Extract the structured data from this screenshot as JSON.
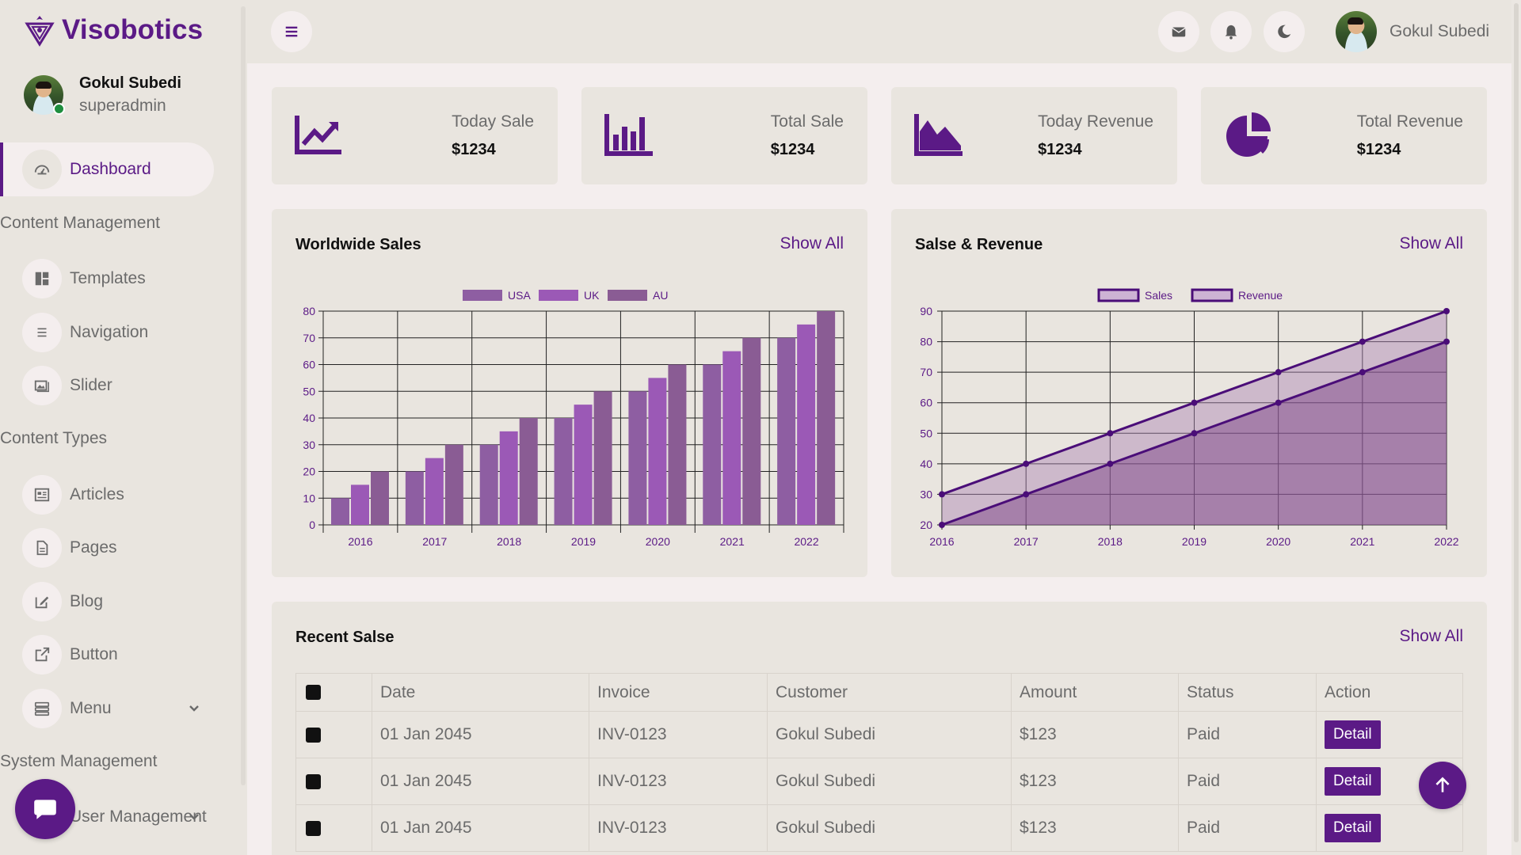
{
  "brand": {
    "name": "Visobotics"
  },
  "user": {
    "name": "Gokul Subedi",
    "role": "superadmin"
  },
  "sidebar": {
    "dashboard": "Dashboard",
    "sections": [
      "Content Management",
      "Content Types",
      "System Management"
    ],
    "items": [
      {
        "label": "Templates",
        "icon": "templates-icon"
      },
      {
        "label": "Navigation",
        "icon": "navigation-icon"
      },
      {
        "label": "Slider",
        "icon": "slider-icon"
      },
      {
        "label": "Articles",
        "icon": "articles-icon"
      },
      {
        "label": "Pages",
        "icon": "pages-icon"
      },
      {
        "label": "Blog",
        "icon": "blog-icon"
      },
      {
        "label": "Button",
        "icon": "button-icon"
      },
      {
        "label": "Menu",
        "icon": "menu-icon"
      },
      {
        "label": "User Management",
        "icon": "user-management-icon"
      }
    ]
  },
  "topbar": {
    "user_name": "Gokul Subedi"
  },
  "stats": [
    {
      "label": "Today Sale",
      "value": "$1234",
      "icon": "line-chart-icon"
    },
    {
      "label": "Total Sale",
      "value": "$1234",
      "icon": "bar-chart-icon"
    },
    {
      "label": "Today Revenue",
      "value": "$1234",
      "icon": "area-chart-icon"
    },
    {
      "label": "Total Revenue",
      "value": "$1234",
      "icon": "pie-chart-icon"
    }
  ],
  "worldwide": {
    "title": "Worldwide Sales",
    "show_all": "Show All"
  },
  "salesrev": {
    "title": "Salse & Revenue",
    "show_all": "Show All"
  },
  "recent": {
    "title": "Recent Salse",
    "show_all": "Show All",
    "headers": [
      "Date",
      "Invoice",
      "Customer",
      "Amount",
      "Status",
      "Action"
    ],
    "rows": [
      {
        "date": "01 Jan 2045",
        "invoice": "INV-0123",
        "customer": "Gokul Subedi",
        "amount": "$123",
        "status": "Paid",
        "action": "Detail"
      },
      {
        "date": "01 Jan 2045",
        "invoice": "INV-0123",
        "customer": "Gokul Subedi",
        "amount": "$123",
        "status": "Paid",
        "action": "Detail"
      },
      {
        "date": "01 Jan 2045",
        "invoice": "INV-0123",
        "customer": "Gokul Subedi",
        "amount": "$123",
        "status": "Paid",
        "action": "Detail"
      }
    ]
  },
  "colors": {
    "accent": "#5b1a86",
    "usa": "#8e5ea2",
    "uk": "#9b59b6",
    "au": "#8a5c94"
  },
  "chart_data": [
    {
      "type": "bar",
      "title": "Worldwide Sales",
      "categories": [
        "2016",
        "2017",
        "2018",
        "2019",
        "2020",
        "2021",
        "2022"
      ],
      "series": [
        {
          "name": "USA",
          "values": [
            10,
            20,
            30,
            40,
            50,
            60,
            70
          ]
        },
        {
          "name": "UK",
          "values": [
            15,
            25,
            35,
            45,
            55,
            65,
            75
          ]
        },
        {
          "name": "AU",
          "values": [
            20,
            30,
            40,
            50,
            60,
            70,
            80
          ]
        }
      ],
      "ylim": [
        0,
        80
      ],
      "yticks": [
        0,
        10,
        20,
        30,
        40,
        50,
        60,
        70,
        80
      ],
      "grid": true,
      "legend": "top"
    },
    {
      "type": "area",
      "title": "Salse & Revenue",
      "categories": [
        "2016",
        "2017",
        "2018",
        "2019",
        "2020",
        "2021",
        "2022"
      ],
      "series": [
        {
          "name": "Sales",
          "values": [
            20,
            30,
            40,
            50,
            60,
            70,
            80
          ]
        },
        {
          "name": "Revenue",
          "values": [
            30,
            40,
            50,
            60,
            70,
            80,
            90
          ]
        }
      ],
      "ylim": [
        20,
        90
      ],
      "yticks": [
        20,
        30,
        40,
        50,
        60,
        70,
        80,
        90
      ],
      "grid": true,
      "legend": "top"
    }
  ]
}
